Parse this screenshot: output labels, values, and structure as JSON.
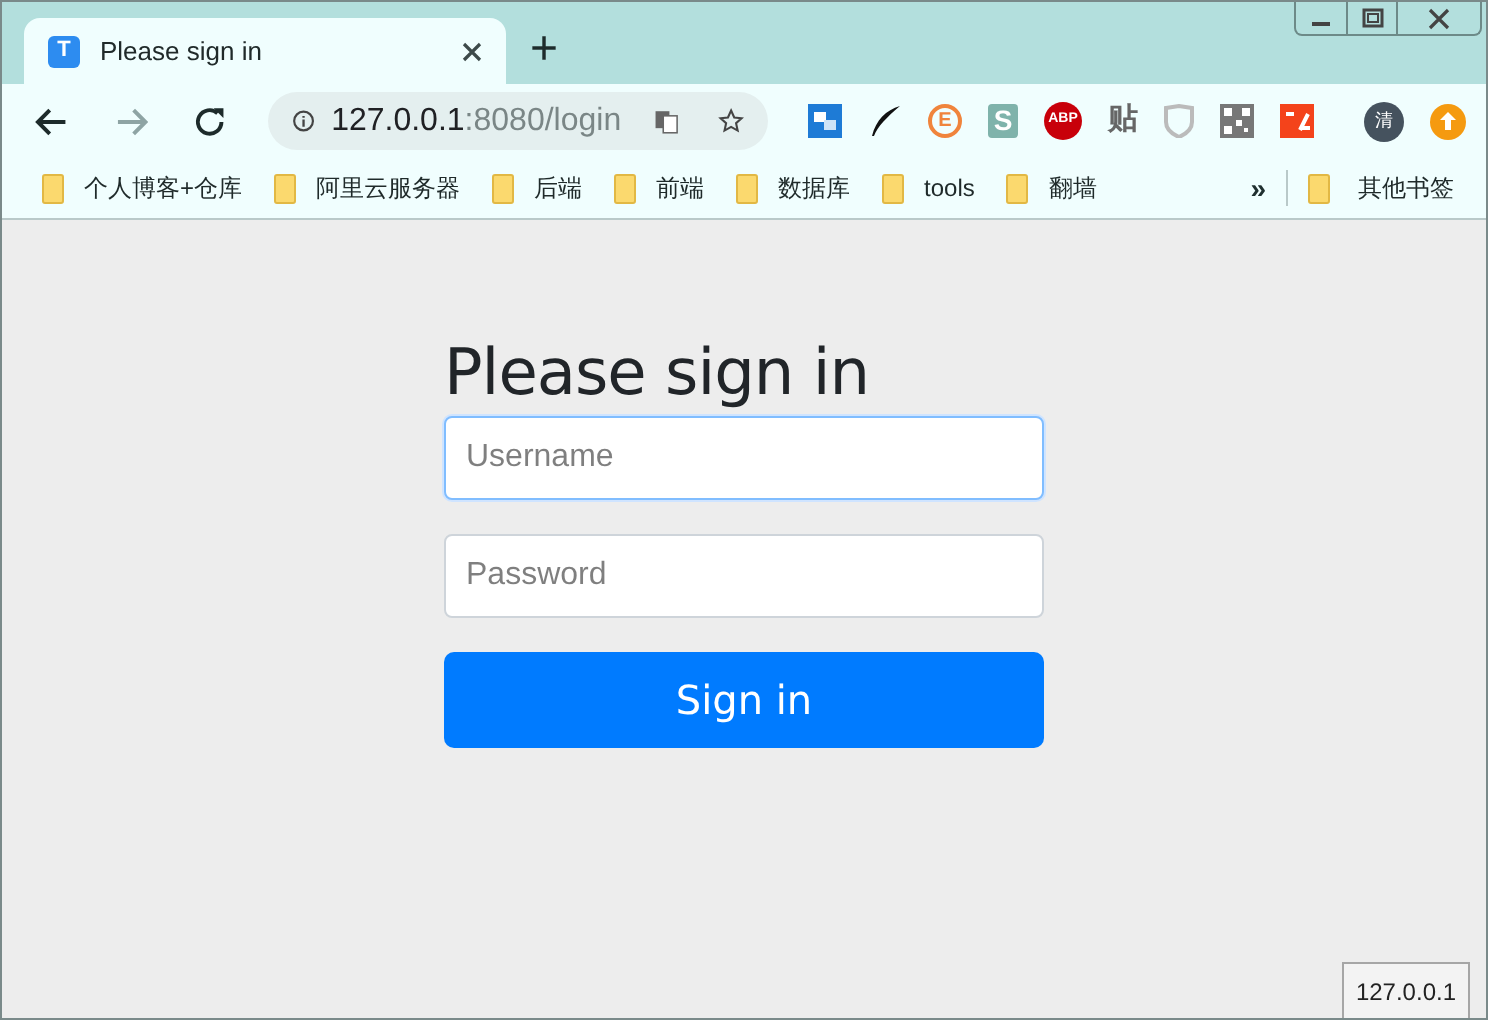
{
  "window": {
    "controls": [
      {
        "kind": "minimize"
      },
      {
        "kind": "maximize"
      },
      {
        "kind": "close"
      }
    ]
  },
  "tabs": [
    {
      "title": "Please sign in",
      "icon_letter": "T",
      "selected": true
    }
  ],
  "new_tab": "+",
  "toolbar": {
    "address": {
      "host": "127.0.0.1",
      "rest": ":8080/login"
    },
    "extensions": [
      {
        "kind": "translate"
      },
      {
        "kind": "feather"
      },
      {
        "kind": "circle",
        "label": "E",
        "color": "#f0843c"
      },
      {
        "kind": "square",
        "label": "S",
        "color": "#7fb3ab"
      },
      {
        "kind": "octagon",
        "label": "ABP",
        "color": "#c8000a"
      },
      {
        "kind": "text",
        "label": "贴"
      },
      {
        "kind": "shield"
      },
      {
        "kind": "qr"
      },
      {
        "kind": "tile",
        "color": "#f4431b"
      },
      {
        "kind": "avatar",
        "label": "清",
        "color": "#45525e"
      },
      {
        "kind": "upload",
        "color": "#f59a10"
      }
    ]
  },
  "bookmarks": [
    {
      "label": "个人博客+仓库"
    },
    {
      "label": "阿里云服务器"
    },
    {
      "label": "后端"
    },
    {
      "label": "前端"
    },
    {
      "label": "数据库"
    },
    {
      "label": "tools"
    },
    {
      "label": "翻墙"
    }
  ],
  "bookmarks_more": "»",
  "other_bookmarks": "其他书签",
  "form": {
    "heading": "Please sign in",
    "fields": [
      {
        "placeholder": "Username",
        "focused": true
      },
      {
        "placeholder": "Password",
        "focused": false
      }
    ],
    "button": "Sign in"
  },
  "status_bar": "127.0.0.1"
}
